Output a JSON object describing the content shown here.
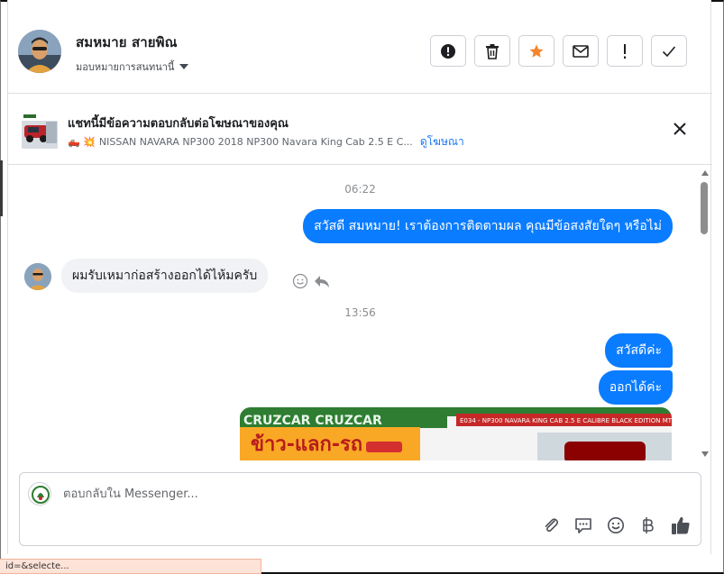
{
  "header": {
    "contact_name": "สมหมาย สายพิณ",
    "assign_label": "มอบหมายการสนทนานี้",
    "actions": [
      {
        "name": "spam-button",
        "icon": "alert-circle-icon"
      },
      {
        "name": "delete-button",
        "icon": "trash-icon"
      },
      {
        "name": "star-button",
        "icon": "star-icon"
      },
      {
        "name": "mark-unread-button",
        "icon": "envelope-icon"
      },
      {
        "name": "follow-up-button",
        "icon": "exclamation-icon"
      },
      {
        "name": "mark-done-button",
        "icon": "check-icon"
      }
    ]
  },
  "ad_banner": {
    "title": "แชทนี้มีข้อความตอบกลับต่อโฆษณาของคุณ",
    "emoji": "🛻 💥",
    "ad_text": "NISSAN NAVARA NP300 2018 NP300 Navara King Cab 2.5 E C...",
    "link": "ดูโฆษณา"
  },
  "conversation": {
    "timestamp_1": "06:22",
    "msg_out_1": "สวัสดี สมหมาย! เราต้องการติดตามผล คุณมีข้อสงสัยใดๆ หรือไม่",
    "msg_in_1": "ผมรับเหมาก่อสร้างออกได้ไห้มครับ",
    "timestamp_2": "13:56",
    "msg_out_2": "สวัสดีค่ะ",
    "msg_out_3": "ออกได้ค่ะ",
    "image_banner_text": "E034 - NP300 NAVARA KING CAB 2.5 E CALIBRE BLACK EDITION MT",
    "image_headline": "ข้าว-แลก-รถ",
    "image_top_text": "CRUZCAR CRUZCAR"
  },
  "composer": {
    "placeholder": "ตอบกลับใน Messenger..."
  },
  "status_bar": {
    "text": "id=&selecte..."
  },
  "colors": {
    "accent": "#0a7cff",
    "star": "#f5852a",
    "link": "#1877f2"
  }
}
